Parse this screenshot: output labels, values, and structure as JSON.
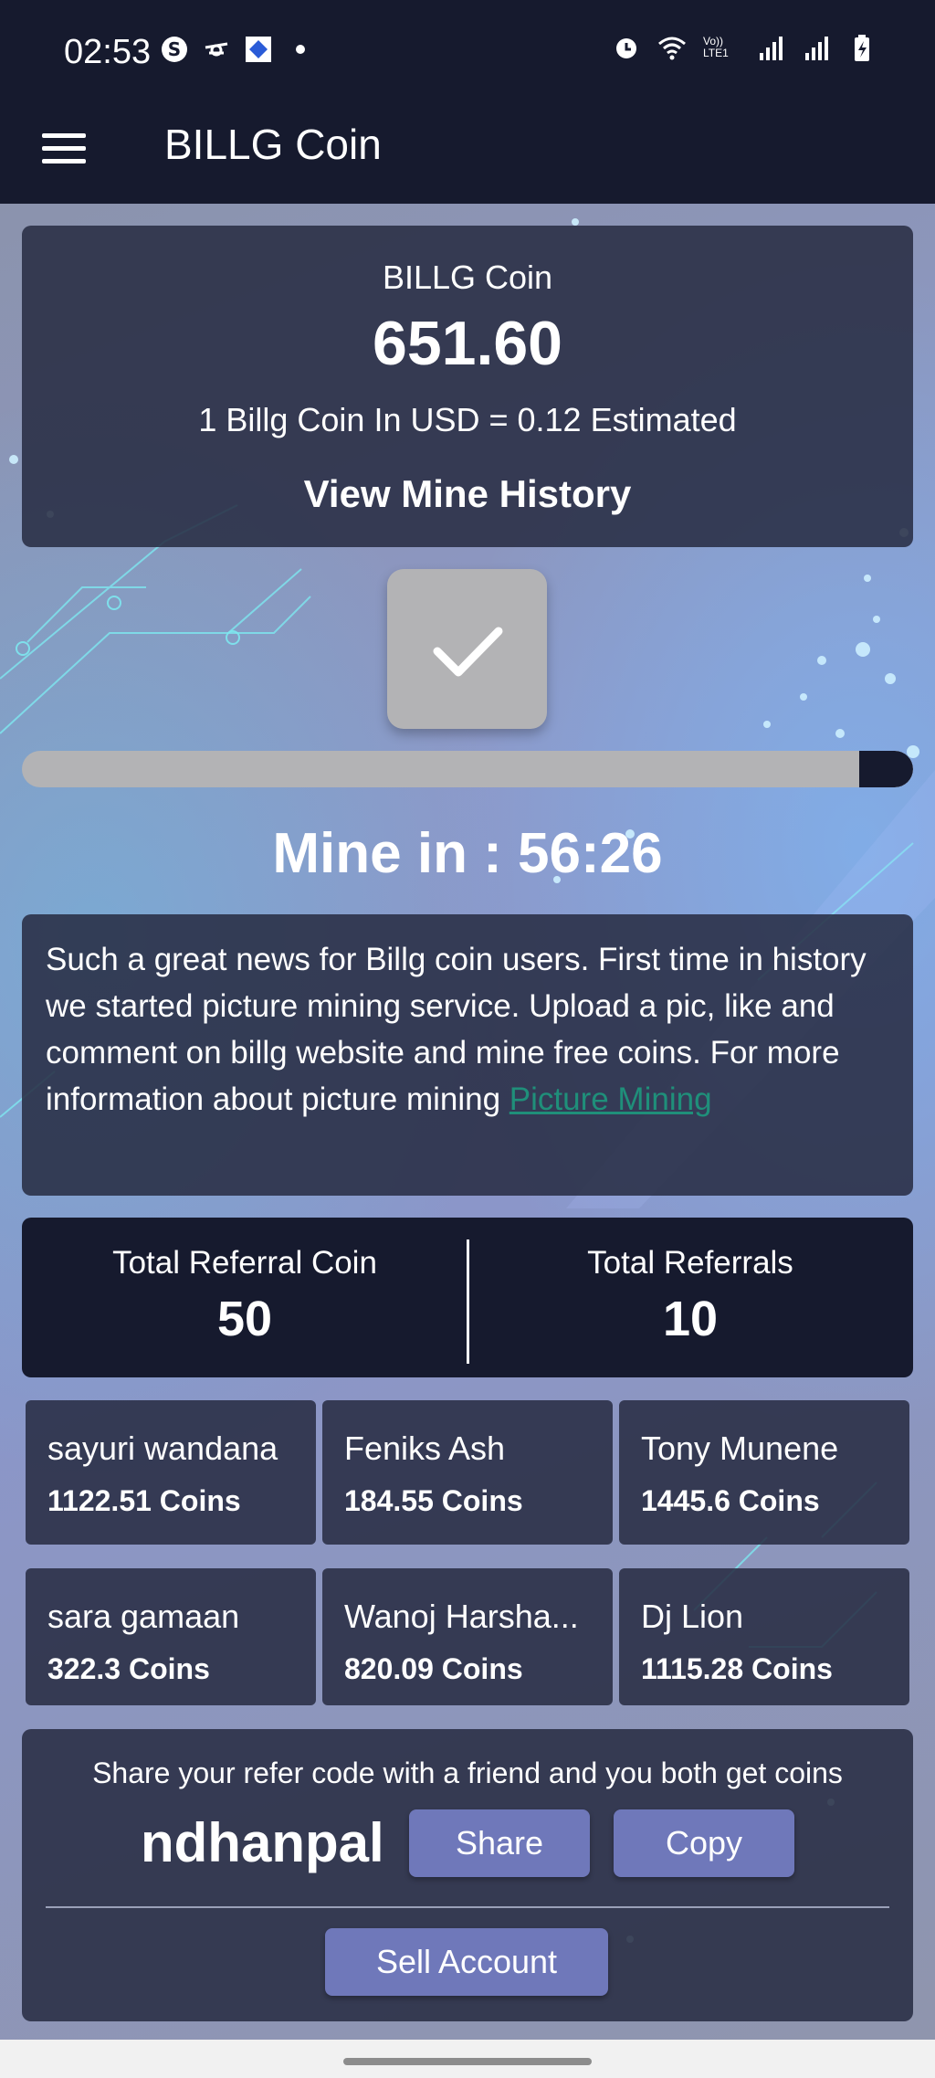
{
  "status_bar": {
    "time": "02:53",
    "left_icons": [
      "s-icon",
      "drone-icon",
      "app-icon",
      "dot-icon"
    ],
    "right_icons": [
      "alarm-icon",
      "wifi-icon",
      "volte-icon",
      "signal-icon",
      "signal-icon",
      "battery-charging-icon"
    ],
    "volte_text": "Vo)) LTE1"
  },
  "app_bar": {
    "title": "BILLG Coin"
  },
  "balance": {
    "coin_name": "BILLG Coin",
    "amount": "651.60",
    "usd_rate": "1 Billg Coin In USD = 0.12 Estimated",
    "history_label": "View Mine History"
  },
  "mining": {
    "progress_remaining_fraction": 0.06,
    "timer_text": "Mine in : 56:26"
  },
  "news": {
    "text": "Such a great news for Billg coin users. First time in history we started picture mining service. Upload a pic, like and comment on billg website and mine free coins. For more information about picture mining ",
    "link_text": "Picture Mining"
  },
  "referrals": {
    "coin_label": "Total Referral Coin",
    "coin_value": "50",
    "count_label": "Total Referrals",
    "count_value": "10",
    "users": [
      {
        "name": "sayuri wandana",
        "coins": "1122.51 Coins"
      },
      {
        "name": "Feniks Ash",
        "coins": "184.55 Coins"
      },
      {
        "name": "Tony Munene",
        "coins": "1445.6 Coins"
      },
      {
        "name": "sara gamaan",
        "coins": "322.3 Coins"
      },
      {
        "name": "Wanoj Harsha...",
        "coins": "820.09 Coins"
      },
      {
        "name": "Dj Lion",
        "coins": "1115.28 Coins"
      }
    ]
  },
  "share": {
    "hint": "Share your refer code with a friend and you both get coins",
    "code": "ndhanpal",
    "share_label": "Share",
    "copy_label": "Copy",
    "sell_label": "Sell Account"
  },
  "colors": {
    "bar_dark": "#161a2e",
    "button": "#6f78ba",
    "link": "#1f8f7a",
    "card": "#262b41"
  }
}
